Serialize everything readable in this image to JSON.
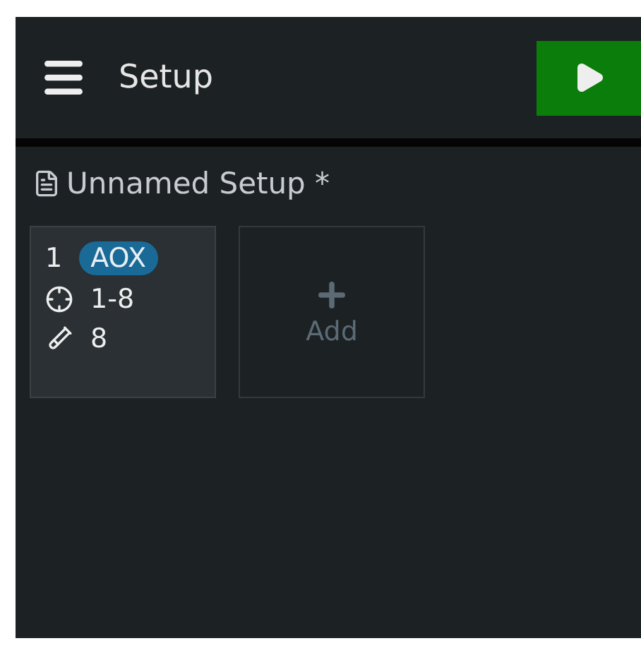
{
  "header": {
    "title": "Setup"
  },
  "document": {
    "name": "Unnamed Setup *"
  },
  "cards": [
    {
      "kind": "item",
      "number": "1",
      "tag": "AOX",
      "range": "1-8",
      "count": "8"
    },
    {
      "kind": "add",
      "label": "Add"
    }
  ]
}
